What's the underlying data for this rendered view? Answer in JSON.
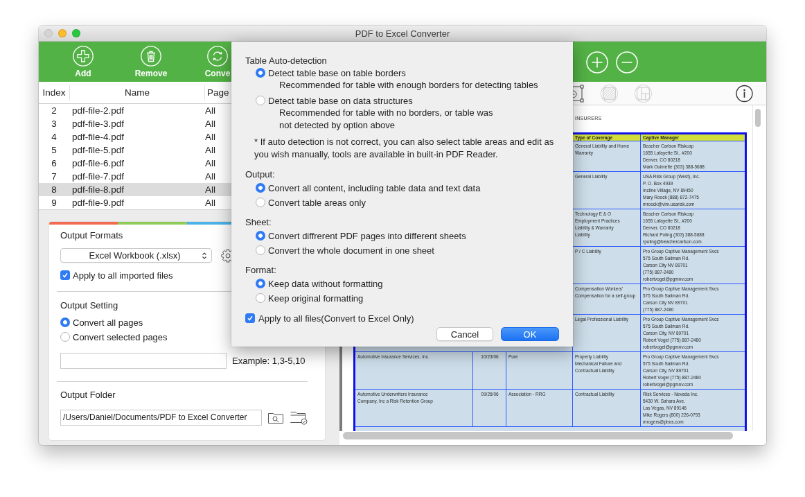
{
  "window": {
    "title": "PDF to Excel Converter",
    "controls": [
      {
        "kind": "close",
        "disabled": true
      },
      {
        "kind": "minimize",
        "disabled": false
      },
      {
        "kind": "zoom",
        "disabled": false
      }
    ]
  },
  "toolbar": {
    "buttons": [
      {
        "kind": "add",
        "label": "Add"
      },
      {
        "kind": "remove",
        "label": "Remove"
      },
      {
        "kind": "convert",
        "label": "Conve"
      }
    ],
    "zoom": [
      {
        "kind": "zoom_in"
      },
      {
        "kind": "zoom_out"
      }
    ]
  },
  "file_list": {
    "columns": [
      "Index",
      "Name",
      "Page"
    ],
    "rows": [
      {
        "index": "2",
        "name": "pdf-file-2.pdf",
        "page": "All",
        "selected": false
      },
      {
        "index": "3",
        "name": "pdf-file-3.pdf",
        "page": "All",
        "selected": false
      },
      {
        "index": "4",
        "name": "pdf-file-4.pdf",
        "page": "All",
        "selected": false
      },
      {
        "index": "5",
        "name": "pdf-file-5.pdf",
        "page": "All",
        "selected": false
      },
      {
        "index": "6",
        "name": "pdf-file-6.pdf",
        "page": "All",
        "selected": false
      },
      {
        "index": "7",
        "name": "pdf-file-7.pdf",
        "page": "All",
        "selected": false
      },
      {
        "index": "8",
        "name": "pdf-file-8.pdf",
        "page": "All",
        "selected": true
      },
      {
        "index": "9",
        "name": "pdf-file-9.pdf",
        "page": "All",
        "selected": false
      }
    ]
  },
  "output_formats": {
    "title": "Output Formats",
    "format": "Excel Workbook (.xlsx)",
    "apply_all": {
      "label": "Apply to all imported files",
      "checked": true
    }
  },
  "output_setting": {
    "title": "Output Setting",
    "options": [
      {
        "label": "Convert all pages",
        "selected": true
      },
      {
        "label": "Convert selected pages",
        "selected": false
      }
    ],
    "example": "Example: 1,3-5,10"
  },
  "output_folder": {
    "title": "Output Folder",
    "path": "/Users/Daniel/Documents/PDF to Excel Converter"
  },
  "viewer": {
    "tools": [
      {
        "kind": "table_minus"
      },
      {
        "kind": "table_hatched"
      },
      {
        "kind": "table_grid"
      },
      {
        "kind": "info"
      }
    ],
    "page": {
      "heading": "INSURERS",
      "table": {
        "header": {
          "column_4": "Type of Coverage",
          "column_5": "Captive Manager"
        },
        "rows": [
          {
            "column_4": [
              "General Liability and Home",
              "Warranty"
            ],
            "column_5": [
              "Beacher Carlson Riskcap",
              "1655 Lafayette St., #200",
              "Denver, CO 80218",
              "Mark Ouimette (303) 388-5688"
            ]
          },
          {
            "column_4": [
              "General Liability"
            ],
            "column_5": [
              "USA Risk Group (West), Inc.",
              "P. O. Box 4939",
              "Incline Village, NV 89450",
              "Mary Roock (888) 872-7475",
              "mroock@vim.usarisk.com"
            ]
          },
          {
            "column_4": [
              "Technology E & O",
              "Employment Practices",
              "Liability & Warranty",
              "Liability"
            ],
            "column_5": [
              "Beacher Carlson Riskcap",
              "1655 Lafayette St., #200",
              "Denver, CO 80218",
              "Richard Poling (303) 388-5688",
              "rpoling@beachercarlson.com"
            ]
          },
          {
            "column_4": [
              "P / C Liability"
            ],
            "column_5": [
              "Pro Group Captive Management Svcs",
              "575 South Saliman Rd.",
              "Carson City NV 89701",
              "(775) 887-2480",
              "robertvogel@pgmnv.com"
            ]
          },
          {
            "column_4": [
              "Compensation Workers'",
              "Compensation for a self-group"
            ],
            "column_5": [
              "Pro Group Captive Management Svcs",
              "575 South Saliman Rd.",
              "Carson City NV 89701",
              "(775) 887-2480"
            ]
          },
          {
            "column_4": [
              "Legal Professional Liability"
            ],
            "column_5": [
              "Pro Group Captive Management Svcs",
              "575 South Saliman Rd.",
              "Carson City, NV 89701",
              "Robert Vogel (775) 887-2480",
              "robertvogel@pgmnv.com"
            ]
          },
          {
            "column_1": [
              "Automotive Insurance Services, Inc."
            ],
            "column_2": [
              "10/23/06"
            ],
            "column_3": [
              "Pure"
            ],
            "column_4": [
              "Property Liability",
              "Mechanical Failure and",
              "Contractual Liability"
            ],
            "column_5": [
              "Pro Group Captive Management Svcs",
              "575 South Saliman Rd.",
              "Carson City, NV 89701",
              "Robert Vogel (775) 887-2480",
              "robertvogel@pgmnv.com"
            ]
          },
          {
            "column_1": [
              "Automotive Underwriters Insurance",
              "Company, Inc a Risk Retention Group"
            ],
            "column_2": [
              "09/26/06"
            ],
            "column_3": [
              "Association - RRG"
            ],
            "column_4": [
              "Contractual Liability"
            ],
            "column_5": [
              "Risk Services - Nevada Inc.",
              "5430 W. Sahara Ave.",
              "Las Vegas, NV 89146",
              "Mike Rogers (800) 226-0793",
              "mrogers@pbos.com"
            ]
          }
        ]
      }
    }
  },
  "dialog": {
    "sections": [
      {
        "title": "Table Auto-detection",
        "options": [
          {
            "label": "Detect table base on table borders",
            "description": [
              "Recommended for table with enough borders for detecting tables"
            ],
            "selected": true
          },
          {
            "label": "Detect table base on data structures",
            "description": [
              "Recommended for table with no borders, or table was",
              "not detected by option above"
            ],
            "selected": false
          }
        ],
        "note": [
          "* If auto detection is not correct, you can also select table areas and edit as",
          "you wish manually, tools are available in built-in PDF Reader."
        ]
      },
      {
        "title": "Output:",
        "options": [
          {
            "label": "Convert all content, including table data and text data",
            "selected": true
          },
          {
            "label": "Convert table areas only",
            "selected": false
          }
        ]
      },
      {
        "title": "Sheet:",
        "options": [
          {
            "label": "Convert diffrerent PDF pages into different sheets",
            "selected": true
          },
          {
            "label": "Convert the whole document in one sheet",
            "selected": false
          }
        ]
      },
      {
        "title": "Format:",
        "options": [
          {
            "label": "Keep data without formatting",
            "selected": true
          },
          {
            "label": "Keep original formatting",
            "selected": false
          }
        ]
      }
    ],
    "apply_all": {
      "label": "Apply to all files(Convert to Excel Only)",
      "checked": true
    },
    "buttons": [
      {
        "kind": "secondary",
        "label": "Cancel"
      },
      {
        "kind": "primary",
        "label": "OK"
      }
    ]
  }
}
